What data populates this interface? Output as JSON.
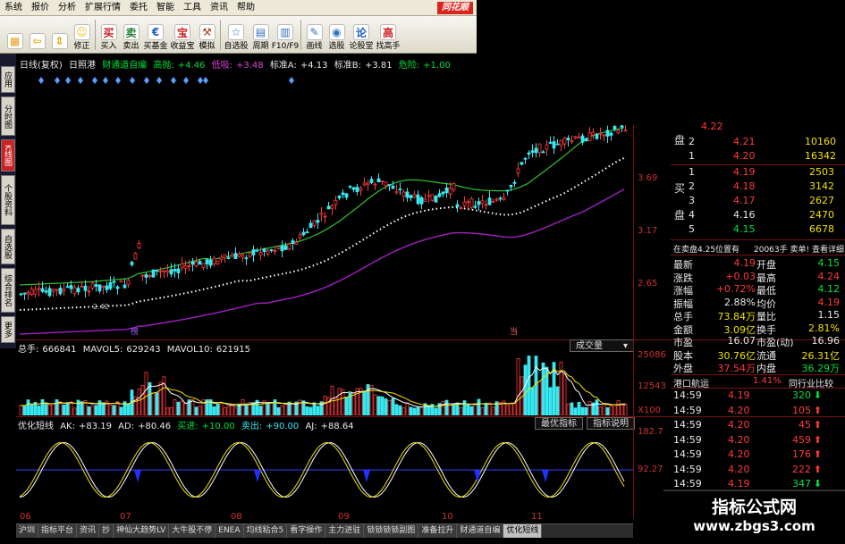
{
  "menu": [
    "系统",
    "报价",
    "分析",
    "扩展行情",
    "委托",
    "智能",
    "工具",
    "资讯",
    "帮助"
  ],
  "brand": "同花顺",
  "toolbar": [
    {
      "label": "",
      "icon": "layout-icon",
      "color": "#e8a020"
    },
    {
      "label": "",
      "icon": "back-arrow-icon",
      "color": "#f0a000"
    },
    {
      "label": "",
      "icon": "up-down-arrows-icon",
      "color": "#f0a000"
    },
    {
      "label": "修正",
      "icon": "smiley-icon",
      "color": "#f0c020"
    },
    {
      "label": "买入",
      "icon": "buy-icon",
      "color": "#d02020"
    },
    {
      "label": "卖出",
      "icon": "sell-icon",
      "color": "#208030"
    },
    {
      "label": "买基金",
      "icon": "fund-icon",
      "color": "#2060c0"
    },
    {
      "label": "收益宝",
      "icon": "treasure-icon",
      "color": "#d02020"
    },
    {
      "label": "模拟",
      "icon": "hammer-icon",
      "color": "#a04020"
    },
    {
      "label": "自选股",
      "icon": "watchlist-icon",
      "color": "#3070c0"
    },
    {
      "label": "周期",
      "icon": "period-icon",
      "color": "#3070c0"
    },
    {
      "label": "F10/F9",
      "icon": "f10-icon",
      "color": "#3070c0"
    },
    {
      "label": "画线",
      "icon": "pen-icon",
      "color": "#3070c0"
    },
    {
      "label": "选股",
      "icon": "stock-pick-icon",
      "color": "#3070c0"
    },
    {
      "label": "论股堂",
      "icon": "discuss-icon",
      "color": "#2060c0"
    },
    {
      "label": "找高手",
      "icon": "expert-icon",
      "color": "#d02020"
    }
  ],
  "toolbar_glyphs": {
    "buy": "买",
    "sell": "卖",
    "treasure": "宝",
    "discuss": "论",
    "expert": "高"
  },
  "side_tabs": [
    "应用",
    "分时图",
    "K线图",
    "个股资料",
    "自选股",
    "综合排名",
    "更多"
  ],
  "kline_header": {
    "period": "日线(复权)",
    "name": "日照港",
    "indicator": "财通道自编",
    "high_label": "高抛:",
    "high_value": "+4.46",
    "low_label": "低吸:",
    "low_value": "+3.48",
    "std_a_label": "标准A:",
    "std_a_value": "+4.13",
    "std_b_label": "标准B:",
    "std_b_value": "+3.81",
    "risk_label": "危险:",
    "risk_value": "+1.00"
  },
  "kline_tags": [
    "榜",
    "当"
  ],
  "kline_low_label": "2.42",
  "price_axis": [
    "3.69",
    "3.17",
    "2.65"
  ],
  "volume_header": {
    "total_label": "总手:",
    "total_value": "666841",
    "ma5_label": "MAVOL5:",
    "ma5_value": "629243",
    "ma10_label": "MAVOL10:",
    "ma10_value": "621915",
    "selector": "成交量"
  },
  "volume_axis": [
    "25086",
    "12543",
    "X100"
  ],
  "indicator_header": {
    "name": "优化短线",
    "ak_label": "AK:",
    "ak_value": "+83.19",
    "ad_label": "AD:",
    "ad_value": "+80.46",
    "buy_label": "买进:",
    "buy_value": "+10.00",
    "sell_label": "卖出:",
    "sell_value": "+90.00",
    "aj_label": "AJ:",
    "aj_value": "+88.64",
    "btn_optimal": "最优指标",
    "btn_help": "指标说明"
  },
  "indicator_axis": [
    "182.7",
    "92.27"
  ],
  "x_axis": [
    "06",
    "07",
    "08",
    "09",
    "10",
    "11"
  ],
  "order_book": {
    "sell_side_label": "盘",
    "buy_side_label_1": "买",
    "buy_side_label_2": "盘",
    "top_partial": "4.22",
    "asks": [
      {
        "level": "2",
        "price": "4.21",
        "vol": "10160"
      },
      {
        "level": "1",
        "price": "4.20",
        "vol": "16342"
      }
    ],
    "bids": [
      {
        "level": "1",
        "price": "4.19",
        "vol": "2503"
      },
      {
        "level": "2",
        "price": "4.18",
        "vol": "3142"
      },
      {
        "level": "3",
        "price": "4.17",
        "vol": "2627"
      },
      {
        "level": "4",
        "price": "4.16",
        "vol": "2470"
      },
      {
        "level": "5",
        "price": "4.15",
        "vol": "6678"
      }
    ]
  },
  "summary": {
    "left": "在卖盘4.25位置有",
    "right": "20063手 卖单!",
    "link": "查看详细"
  },
  "stats": [
    {
      "l1": "最新",
      "v1": "4.19",
      "l2": "开盘",
      "v2": "4.15",
      "c1": "red",
      "c2": "green"
    },
    {
      "l1": "涨跌",
      "v1": "+0.03",
      "l2": "最高",
      "v2": "4.24",
      "c1": "red",
      "c2": "red"
    },
    {
      "l1": "涨幅",
      "v1": "+0.72%",
      "l2": "最低",
      "v2": "4.12",
      "c1": "red",
      "c2": "green"
    },
    {
      "l1": "振幅",
      "v1": "2.88%",
      "l2": "均价",
      "v2": "4.19",
      "c1": "white",
      "c2": "red"
    },
    {
      "l1": "总手",
      "v1": "73.84万",
      "l2": "量比",
      "v2": "1.15",
      "c1": "yellow",
      "c2": "white"
    },
    {
      "l1": "金额",
      "v1": "3.09亿",
      "l2": "换手",
      "v2": "2.81%",
      "c1": "yellow",
      "c2": "yellow"
    },
    {
      "l1": "市盈",
      "v1": "16.07",
      "l2": "市盈(动)",
      "v2": "16.96",
      "c1": "white",
      "c2": "white"
    },
    {
      "l1": "股本",
      "v1": "30.76亿",
      "l2": "流通",
      "v2": "26.31亿",
      "c1": "yellow",
      "c2": "yellow"
    },
    {
      "l1": "外盘",
      "v1": "37.54万",
      "l2": "内盘",
      "v2": "36.29万",
      "c1": "red",
      "c2": "green"
    }
  ],
  "industry": {
    "name": "港口航运",
    "change": "1.41%",
    "button": "同行业比较"
  },
  "ticks": [
    {
      "time": "14:59",
      "price": "4.19",
      "vol": "320",
      "dir": "down"
    },
    {
      "time": "14:59",
      "price": "4.20",
      "vol": "105",
      "dir": "up"
    },
    {
      "time": "14:59",
      "price": "4.20",
      "vol": "45",
      "dir": "up"
    },
    {
      "time": "14:59",
      "price": "4.20",
      "vol": "459",
      "dir": "up"
    },
    {
      "time": "14:59",
      "price": "4.20",
      "vol": "176",
      "dir": "up"
    },
    {
      "time": "14:59",
      "price": "4.20",
      "vol": "222",
      "dir": "up"
    },
    {
      "time": "14:59",
      "price": "4.19",
      "vol": "347",
      "dir": "down"
    },
    {
      "time": "14:59",
      "price": "",
      "vol": "",
      "dir": ""
    }
  ],
  "watermark": {
    "title": "指标公式网",
    "url": "www.zbgs3.com"
  },
  "bottom_tabs": [
    "沪圳",
    "指标平台",
    "资讯",
    "抄",
    "神仙大趋势LV",
    "大牛股不停",
    "ENEA",
    "均线粘合5",
    "看字操作",
    "主力进驻",
    "锁锁锁锁副图",
    "准备拉升",
    "财通道自编",
    "优化短线"
  ],
  "colors": {
    "up": "#ff3a3a",
    "down": "#38e8f0",
    "ma_green": "#30c030",
    "ma_white": "#e0e0e0",
    "ma_purple": "#a020c0",
    "dots": "#ffffff",
    "grid": "#7a1010"
  }
}
